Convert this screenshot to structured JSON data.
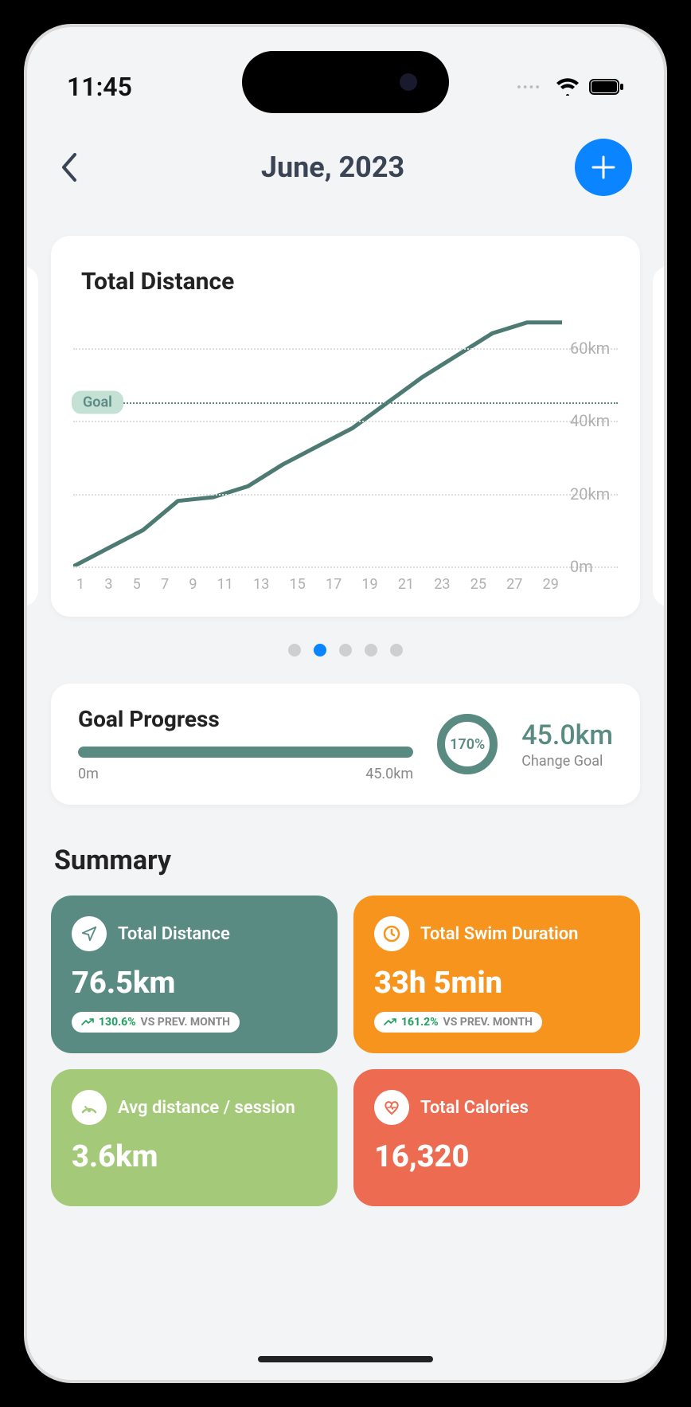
{
  "status": {
    "time": "11:45"
  },
  "header": {
    "title": "June, 2023"
  },
  "chart": {
    "title": "Total Distance",
    "goal_label": "Goal"
  },
  "chart_data": {
    "type": "line",
    "title": "Total Distance",
    "xlabel": "",
    "ylabel": "",
    "ylim": [
      0,
      70
    ],
    "x": [
      1,
      3,
      5,
      7,
      9,
      11,
      13,
      15,
      17,
      19,
      21,
      23,
      25,
      27,
      29
    ],
    "values": [
      0,
      5,
      10,
      18,
      19,
      22,
      28,
      33,
      38,
      45,
      52,
      58,
      64,
      67,
      67
    ],
    "goal": 45,
    "y_ticks": [
      "0m",
      "20km",
      "40km",
      "60km"
    ]
  },
  "pager": {
    "count": 5,
    "active": 1
  },
  "goal": {
    "title": "Goal Progress",
    "ring": "170%",
    "value": "45.0km",
    "change_label": "Change Goal",
    "min": "0m",
    "max": "45.0km"
  },
  "summary": {
    "title": "Summary",
    "tiles": [
      {
        "label": "Total Distance",
        "value": "76.5km",
        "badge_pct": "130.6%",
        "badge_text": "VS PREV. MONTH"
      },
      {
        "label": "Total Swim Duration",
        "value": "33h 5min",
        "badge_pct": "161.2%",
        "badge_text": "VS PREV. MONTH"
      },
      {
        "label": "Avg distance / session",
        "value": "3.6km"
      },
      {
        "label": "Total Calories",
        "value": "16,320"
      }
    ]
  }
}
